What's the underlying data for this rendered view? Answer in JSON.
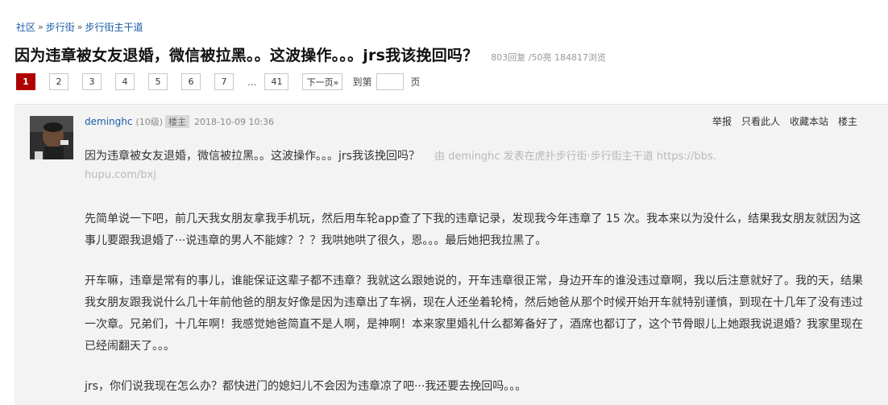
{
  "breadcrumb": [
    "社区",
    "步行街",
    "步行街主干道"
  ],
  "breadcrumb_sep": "»",
  "thread": {
    "title": "因为违章被女友退婚，微信被拉黑。。这波操作。。。jrs我该挽回吗？",
    "stats": "803回复 /50亮 184817浏览"
  },
  "pagination": {
    "pages": [
      "1",
      "2",
      "3",
      "4",
      "5",
      "6",
      "7"
    ],
    "ellipsis": "...",
    "last": "41",
    "next": "下一页»",
    "goto_label": "到第",
    "goto_suffix": "页"
  },
  "post": {
    "author": "deminghc",
    "level": "(10级)",
    "badge": "楼主",
    "time": "2018-10-09 10:36",
    "actions": [
      "举报",
      "只看此人",
      "收藏本站",
      "楼主"
    ],
    "quote_title": "因为违章被女友退婚，微信被拉黑。。这波操作。。。jrs我该挽回吗？",
    "quote_source": "由 deminghc 发表在虎扑步行街·步行街主干道 https://bbs.",
    "quote_url": "hupu.com/bxj",
    "paragraphs": [
      "先简单说一下吧，前几天我女朋友拿我手机玩，然后用车轮app查了下我的违章记录，发现我今年违章了 15 次。我本来以为没什么，结果我女朋友就因为这事儿要跟我退婚了···说违章的男人不能嫁？？？我哄她哄了很久，恩。。。最后她把我拉黑了。",
      "开车嘛，违章是常有的事儿，谁能保证这辈子都不违章？我就这么跟她说的，开车违章很正常，身边开车的谁没违过章啊，我以后注意就好了。我的天，结果我女朋友跟我说什么几十年前他爸的朋友好像是因为违章出了车祸，现在人还坐着轮椅，然后她爸从那个时候开始开车就特别谨慎，到现在十几年了没有违过一次章。兄弟们，十几年啊！我感觉她爸简直不是人啊，是神啊！本来家里婚礼什么都筹备好了，酒席也都订了，这个节骨眼儿上她跟我说退婚？我家里现在已经闹翻天了。。。",
      "jrs，你们说我现在怎么办？都快进门的媳妇儿不会因为违章凉了吧···我还要去挽回吗。。。"
    ]
  }
}
